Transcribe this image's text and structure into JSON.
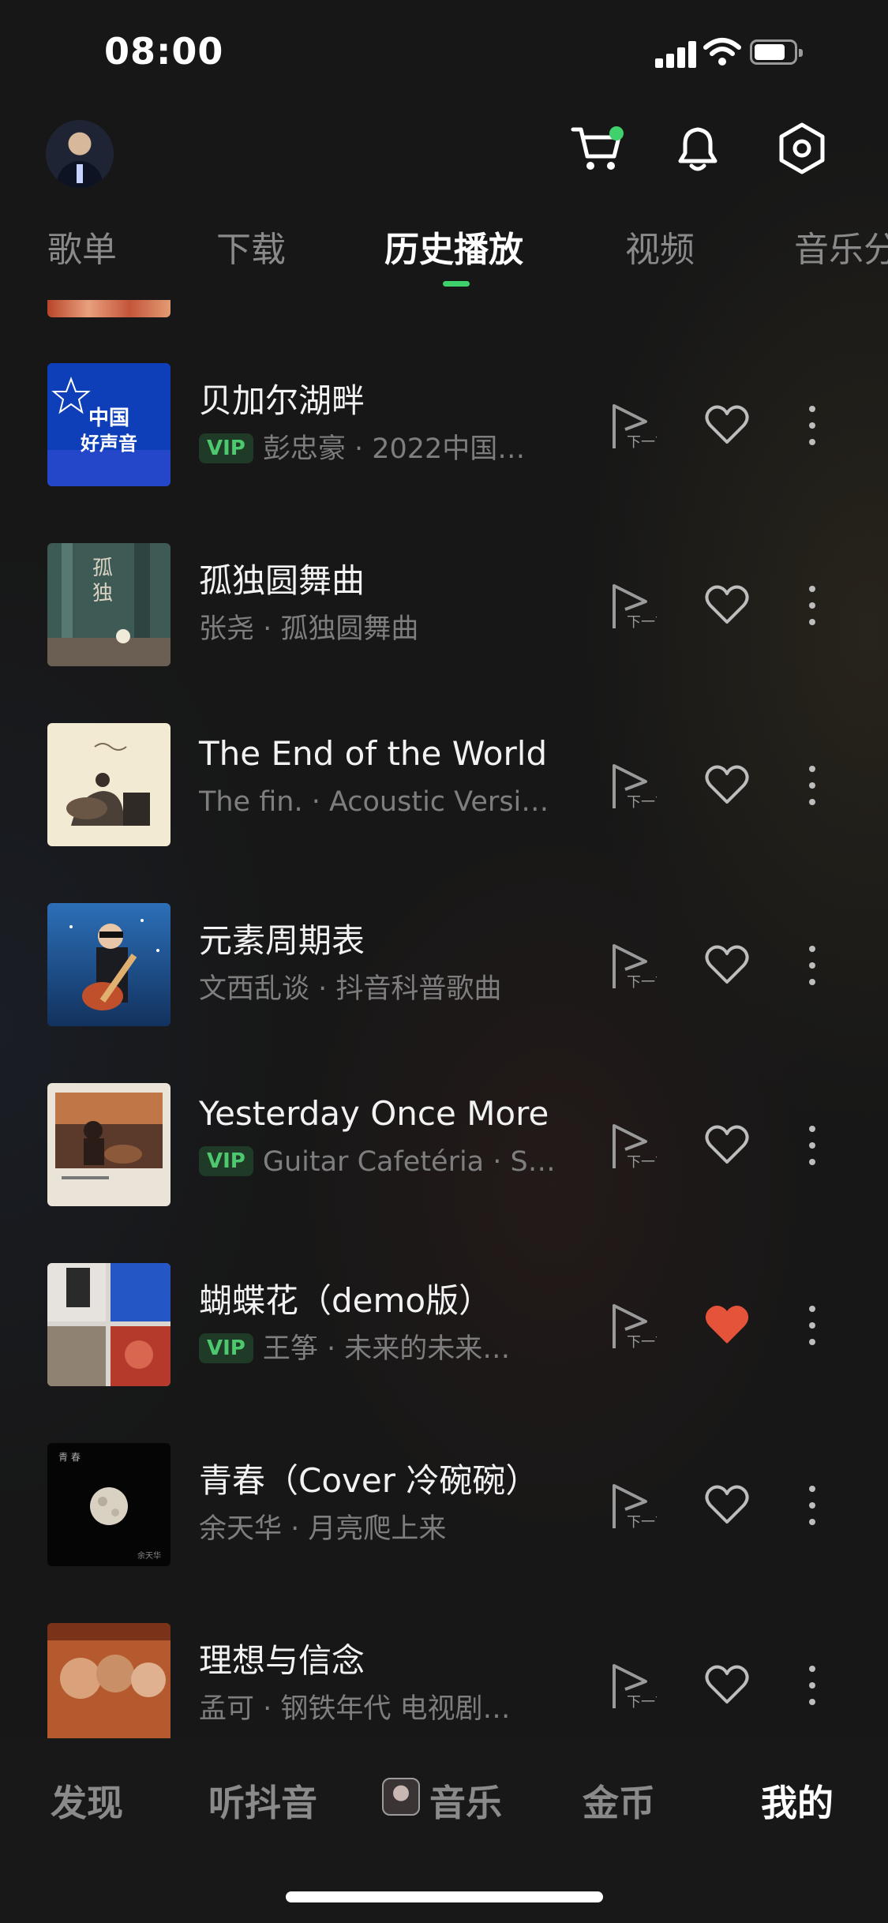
{
  "status_bar": {
    "time": "08:00"
  },
  "header": {
    "avatar": "avatar",
    "icons": [
      "cart-icon",
      "bell-icon",
      "settings-icon"
    ],
    "accent": "#3fd16c"
  },
  "tabs": [
    {
      "label": "歌单",
      "active": false
    },
    {
      "label": "下载",
      "active": false
    },
    {
      "label": "历史播放",
      "active": true
    },
    {
      "label": "视频",
      "active": false
    },
    {
      "label": "音乐分",
      "active": false
    }
  ],
  "songs": [
    {
      "title": "贝加尔湖畔",
      "vip": "VIP",
      "subtitle": "彭忠豪 · 2022中国…",
      "liked": false
    },
    {
      "title": "孤独圆舞曲",
      "vip": "",
      "subtitle": "张尧 · 孤独圆舞曲",
      "liked": false
    },
    {
      "title": "The End of the World",
      "vip": "",
      "subtitle": "The fin. · Acoustic Versi…",
      "liked": false
    },
    {
      "title": "元素周期表",
      "vip": "",
      "subtitle": "文西乱谈 · 抖音科普歌曲",
      "liked": false
    },
    {
      "title": "Yesterday Once More",
      "vip": "VIP",
      "subtitle": "Guitar Cafetéria · S…",
      "liked": false
    },
    {
      "title": "蝴蝶花（demo版）",
      "vip": "VIP",
      "subtitle": "王筝 · 未来的未来…",
      "liked": true
    },
    {
      "title": "青春（Cover 冷碗碗）",
      "vip": "",
      "subtitle": "余天华 · 月亮爬上来",
      "liked": false
    },
    {
      "title": "理想与信念",
      "vip": "",
      "subtitle": "孟可 · 钢铁年代 电视剧…",
      "liked": false
    }
  ],
  "row_actions": {
    "next_icon": "play-next-icon",
    "next_label": "下一首",
    "like_icon": "heart-icon",
    "more_icon": "more-icon"
  },
  "liked_color": "#e5533b",
  "bottom_nav": [
    {
      "label": "发现",
      "active": false
    },
    {
      "label": "听抖音",
      "active": false
    },
    {
      "label": "音乐",
      "active": false
    },
    {
      "label": "金币",
      "active": false
    },
    {
      "label": "我的",
      "active": true
    }
  ]
}
